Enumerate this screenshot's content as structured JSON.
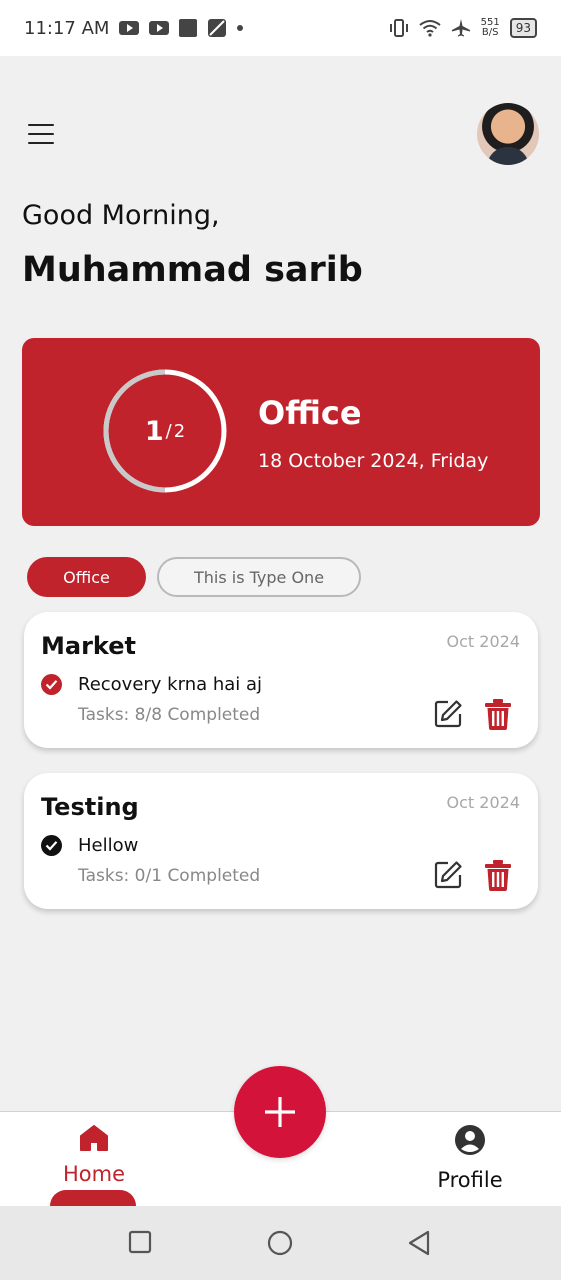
{
  "status_bar": {
    "time": "11:17 AM",
    "net_speed_value": "551",
    "net_speed_unit": "B/S",
    "battery": "93"
  },
  "header": {
    "menu_icon": "hamburger-menu-icon",
    "avatar_icon": "user-avatar"
  },
  "greeting": "Good Morning,",
  "user_name": "Muhammad sarib",
  "summary": {
    "completed": "1",
    "separator": "/",
    "total": "2",
    "progress_fraction": 0.5,
    "title": "Office",
    "date": "18 October 2024, Friday",
    "color": "#c1232c"
  },
  "filters": [
    {
      "label": "Office",
      "active": true
    },
    {
      "label": "This is Type One",
      "active": false
    }
  ],
  "tasks": [
    {
      "title": "Market",
      "date": "Oct 2024",
      "item": "Recovery krna hai aj",
      "item_checked_color": "#c1232c",
      "progress": "Tasks: 8/8 Completed"
    },
    {
      "title": "Testing",
      "date": "Oct 2024",
      "item": "Hellow",
      "item_checked_color": "#111111",
      "progress": "Tasks: 0/1 Completed"
    }
  ],
  "bottom_nav": {
    "home_label": "Home",
    "profile_label": "Profile",
    "fab_icon": "plus-icon",
    "accent": "#c1232c",
    "fab_color": "#d4133a"
  }
}
